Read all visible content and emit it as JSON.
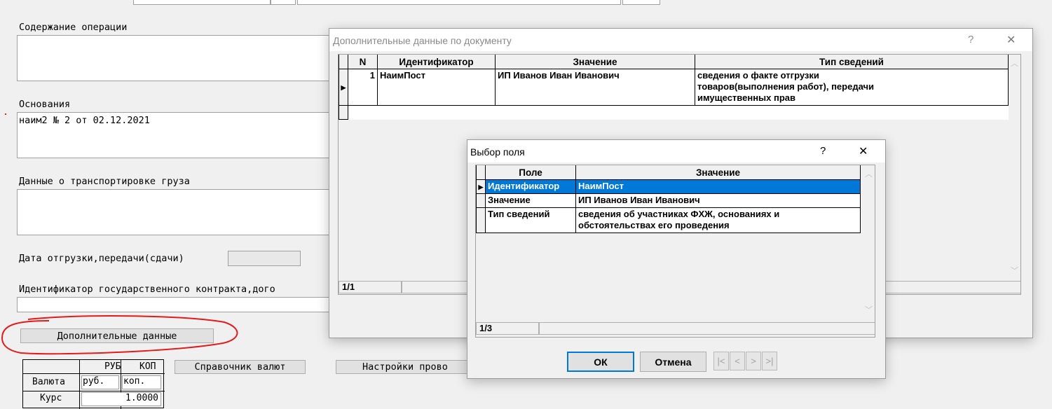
{
  "background_form": {
    "op_content_label": "Содержание операции",
    "basis_label": "Основания",
    "basis_value": "наим2 № 2 от 02.12.2021",
    "transport_label": "Данные о транспортировке груза",
    "ship_date_label": "Дата отгрузки,передачи(сдачи)",
    "contract_id_label": "Идентификатор государственного контракта,дого",
    "extra_data_button": "Дополнительные данные",
    "currency_ref_button": "Справочник валют",
    "settings_button": "Настройки прово",
    "currency_table": {
      "col_rub": "РУБ",
      "col_kop": "КОП",
      "row_currency": "Валюта",
      "rub_value": "руб.",
      "kop_value": "коп.",
      "row_rate": "Курс",
      "rate_value": "1.0000"
    }
  },
  "doc_dialog": {
    "title": "Дополнительные данные по документу",
    "help": "?",
    "close": "✕",
    "columns": [
      "N",
      "Идентификатор",
      "Значение",
      "Тип сведений"
    ],
    "rows": [
      {
        "n": "1",
        "id": "НаимПост",
        "value": "ИП Иванов Иван Иванович",
        "type": "сведения о факте отгрузки товаров(выполнения работ), передачи имущественных прав"
      }
    ],
    "status": "1/1"
  },
  "field_dialog": {
    "title": "Выбор поля",
    "help": "?",
    "close": "✕",
    "columns": [
      "Поле",
      "Значение"
    ],
    "rows": [
      {
        "field": "Идентификатор",
        "value": "НаимПост",
        "selected": true
      },
      {
        "field": "Значение",
        "value": "ИП Иванов Иван Иванович",
        "selected": false
      },
      {
        "field": "Тип сведений",
        "value": "сведения об участниках ФХЖ, основаниях и обстоятельствах его проведения",
        "selected": false
      }
    ],
    "status": "1/3",
    "ok": "ОК",
    "cancel": "Отмена",
    "nav": [
      "|<",
      "<",
      ">",
      ">|"
    ]
  },
  "colors": {
    "selection": "#0078d7",
    "annotation": "#e31b1b"
  }
}
